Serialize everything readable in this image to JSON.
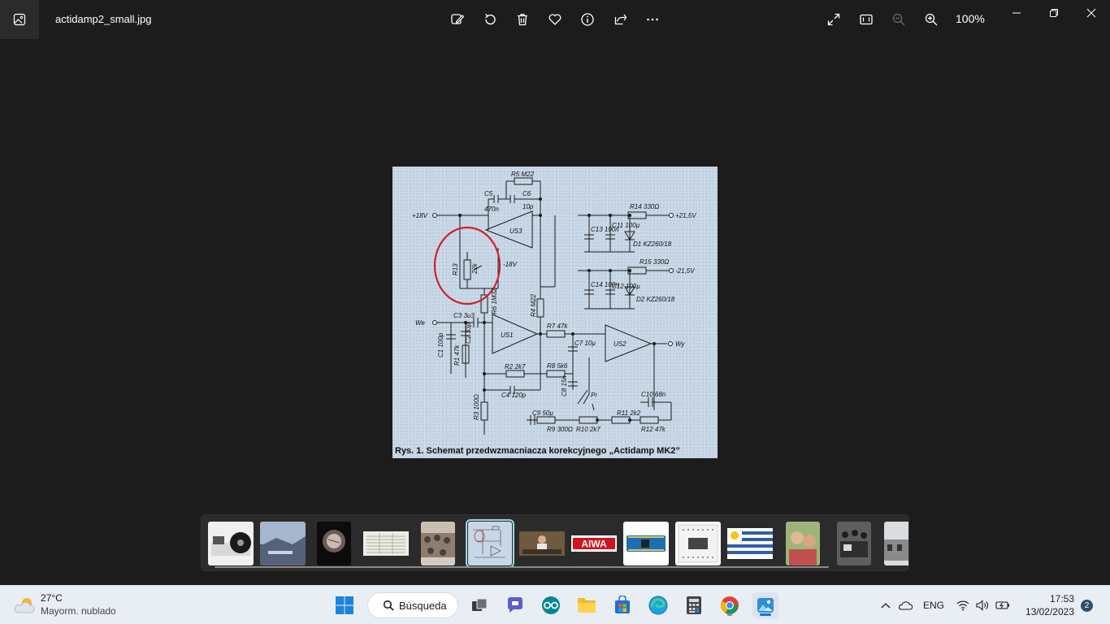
{
  "titlebar": {
    "filename": "actidamp2_small.jpg",
    "zoom": "100%"
  },
  "image": {
    "caption": "Rys. 1. Schemat przedwzmacniacza korekcyjnego „Actidamp MK2”",
    "labels": {
      "r5": "R5 M22",
      "c5": "C5",
      "c6": "C6",
      "c5v": "470n",
      "c6v": "10p",
      "p18": "+18V",
      "us3": "US3",
      "r13": "R13",
      "r13v": "22k",
      "m18": "-18V",
      "r6": "R6 1M32",
      "r4": "R4 M22",
      "we": "We",
      "c3": "C3 3u3",
      "c1": "C1 100p",
      "r1": "R1 47k",
      "c2": "C2 33p",
      "us1": "US1",
      "r2": "R2 2k7",
      "c4": "C4 120p",
      "r3": "R3 100Ω",
      "r7": "R7 47k",
      "r8": "R8 5k6",
      "c7": "C7 10µ",
      "c8": "C8 15n",
      "us2": "US2",
      "wy": "Wy",
      "pr": "Pr",
      "c9": "C9 50µ",
      "r9": "R9 300Ω",
      "r10": "R10 2k7",
      "r11": "R11 2k2",
      "r12": "R12 47k",
      "c10": "C10 68n",
      "r14": "R14 330Ω",
      "r15": "R15 330Ω",
      "p215": "+21,5V",
      "m215": "-21,5V",
      "c13": "C13 100n",
      "c11": "C11 100µ",
      "d1": "D1 KZ260/18",
      "c14": "C14 100n",
      "c12": "C12 100µ",
      "d2": "D2 KZ260/18"
    }
  },
  "filmstrip": {
    "thumbnails": [
      {
        "name": "thumb-turntable",
        "color": "#e8e8e8"
      },
      {
        "name": "thumb-landscape",
        "color": "#8aa0c0"
      },
      {
        "name": "thumb-lens",
        "color": "#1a1414"
      },
      {
        "name": "thumb-document",
        "color": "#e6e6df"
      },
      {
        "name": "thumb-crowd",
        "color": "#8c7d70"
      },
      {
        "name": "thumb-schematic",
        "color": "#c8d7e6"
      },
      {
        "name": "thumb-person-desk",
        "color": "#6e5a40"
      },
      {
        "name": "thumb-aiwa-logo",
        "color": "#ffffff",
        "text": "AIWA"
      },
      {
        "name": "thumb-arduino-nano",
        "color": "#ffffff"
      },
      {
        "name": "thumb-breadboard",
        "color": "#f2f2f2"
      },
      {
        "name": "thumb-uruguay-flag",
        "color": "#ffffff"
      },
      {
        "name": "thumb-women",
        "color": "#c9a882"
      },
      {
        "name": "thumb-old-group-photo",
        "color": "#6a6a6a"
      },
      {
        "name": "thumb-building",
        "color": "#b0b0b0"
      }
    ]
  },
  "taskbar": {
    "weather_temp": "27°C",
    "weather_desc": "Mayorm. nublado",
    "search_label": "Búsqueda",
    "language": "ENG",
    "time": "17:53",
    "date": "13/02/2023",
    "notification_count": "2"
  }
}
